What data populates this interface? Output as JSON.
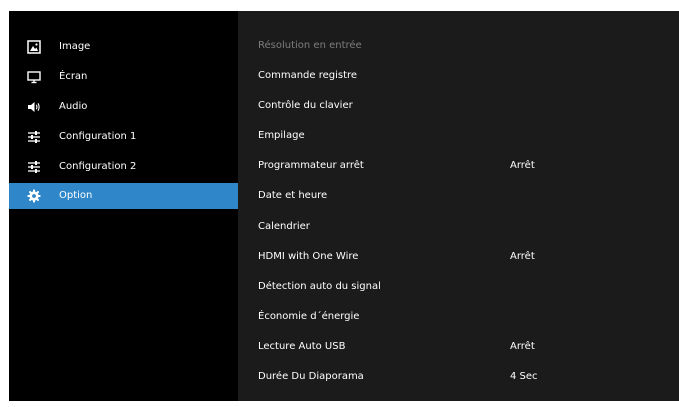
{
  "sidebar": {
    "items": [
      {
        "label": "Image",
        "icon": "image-icon"
      },
      {
        "label": "Écran",
        "icon": "monitor-icon"
      },
      {
        "label": "Audio",
        "icon": "speaker-icon"
      },
      {
        "label": "Configuration 1",
        "icon": "sliders-icon"
      },
      {
        "label": "Configuration 2",
        "icon": "sliders-icon"
      },
      {
        "label": "Option",
        "icon": "gear-icon"
      }
    ],
    "selected_index": 5,
    "selected_color": "#2f86c8"
  },
  "menu": {
    "items": [
      {
        "label": "Résolution en entrée",
        "value": "",
        "disabled": true
      },
      {
        "label": "Commande registre",
        "value": ""
      },
      {
        "label": "Contrôle du clavier",
        "value": ""
      },
      {
        "label": "Empilage",
        "value": ""
      },
      {
        "label": "Programmateur arrêt",
        "value": "Arrêt"
      },
      {
        "label": "Date et heure",
        "value": ""
      },
      {
        "label": "Calendrier",
        "value": ""
      },
      {
        "label": "HDMI with One Wire",
        "value": "Arrêt"
      },
      {
        "label": "Détection auto du signal",
        "value": ""
      },
      {
        "label": "Économie d´énergie",
        "value": ""
      },
      {
        "label": "Lecture Auto USB",
        "value": "Arrêt"
      },
      {
        "label": "Durée Du Diaporama",
        "value": "4 Sec"
      }
    ]
  }
}
